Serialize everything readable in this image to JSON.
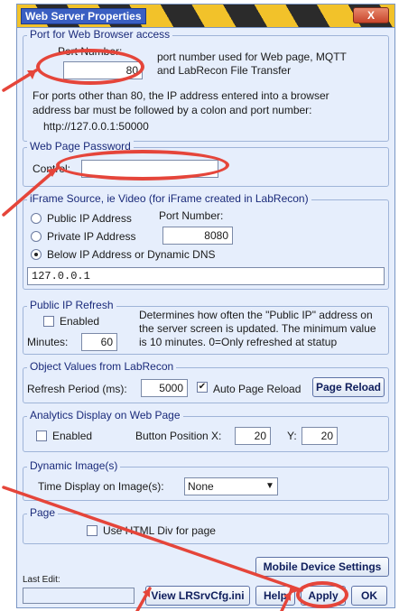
{
  "window": {
    "title": "Web Server Properties",
    "close_glyph": "X"
  },
  "port": {
    "legend": "Port for Web Browser access",
    "port_label": "Port Number:",
    "port_value": "80",
    "desc_line1": "port number used for Web page, MQTT",
    "desc_line2": "and LabRecon File Transfer",
    "note_line1": "For ports other than 80, the IP address entered into a browser",
    "note_line2": "address bar must be followed by a colon and port number:",
    "note_line3": "http://127.0.0.1:50000"
  },
  "password": {
    "legend": "Web Page Password",
    "control_label": "Control:",
    "control_value": ""
  },
  "iframe": {
    "legend": "iFrame Source, ie Video (for iFrame created in LabRecon)",
    "radio_public": "Public IP Address",
    "radio_private": "Private IP Address",
    "radio_below": "Below IP Address or Dynamic DNS",
    "selected": "below",
    "port_label": "Port Number:",
    "port_value": "8080",
    "address_value": "127.0.0.1"
  },
  "refresh": {
    "legend": "Public IP Refresh",
    "enabled_label": "Enabled",
    "enabled": false,
    "minutes_label": "Minutes:",
    "minutes_value": "60",
    "desc_line1": "Determines how often the \"Public IP\" address on",
    "desc_line2": "the server screen is updated.  The minimum value",
    "desc_line3": "is 10 minutes.  0=Only refreshed at statup"
  },
  "objects": {
    "legend": "Object Values from LabRecon",
    "period_label": "Refresh Period (ms):",
    "period_value": "5000",
    "auto_reload_label": "Auto Page Reload",
    "auto_reload": true,
    "page_reload_button": "Page Reload"
  },
  "analytics": {
    "legend": "Analytics Display on Web Page",
    "enabled_label": "Enabled",
    "enabled": false,
    "button_pos_label": "Button Position X:",
    "x_value": "20",
    "y_label": "Y:",
    "y_value": "20"
  },
  "dynamic": {
    "legend": "Dynamic Image(s)",
    "time_label": "Time Display on Image(s):",
    "time_value": "None"
  },
  "page": {
    "legend": "Page",
    "html_div_label": "Use HTML Div for page",
    "html_div": false
  },
  "footer": {
    "mobile_button": "Mobile Device Settings",
    "last_edit_label": "Last Edit:",
    "last_edit_value": "",
    "view_cfg_button": "View LRSrvCfg.ini",
    "help_button": "Help",
    "apply_button": "Apply",
    "ok_button": "OK"
  },
  "colors": {
    "annotation": "#e5453a",
    "panel": "#e6eefc",
    "title_stripe_yellow": "#f2c22a"
  },
  "icons": {
    "check": "check-mark",
    "dropdown": "chevron-down-icon",
    "close": "close-icon"
  }
}
